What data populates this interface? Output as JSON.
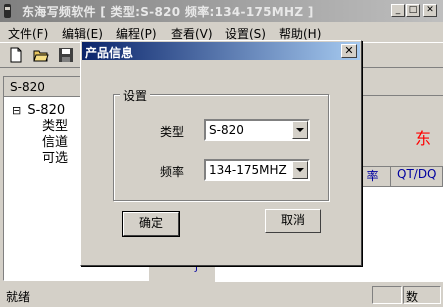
{
  "window": {
    "title": "东海写频软件  [ 类型:S-820  频率:134-175MHZ ]",
    "minimize": "_",
    "maximize": "□",
    "close": "✕"
  },
  "menu": [
    {
      "label": "文件(F)"
    },
    {
      "label": "编辑(E)"
    },
    {
      "label": "编程(P)"
    },
    {
      "label": "查看(V)"
    },
    {
      "label": "设置(S)"
    },
    {
      "label": "帮助(H)"
    }
  ],
  "toolbar": {
    "icons": [
      "new-file-icon",
      "open-folder-icon",
      "save-icon"
    ]
  },
  "left_pane": {
    "header": "S-820",
    "tree": [
      {
        "label": "S-820",
        "expander": "⊟"
      },
      {
        "label": "类型"
      },
      {
        "label": "信道"
      },
      {
        "label": "可选"
      }
    ]
  },
  "right_pane": {
    "brand_text": "东",
    "columns": [
      {
        "label": "率"
      },
      {
        "label": "QT/DQ"
      }
    ],
    "row_marker": "J"
  },
  "status": {
    "text": "就绪",
    "panel_label": "数"
  },
  "dialog": {
    "title": "产品信息",
    "close": "✕",
    "group_label": "设置",
    "type_label": "类型",
    "type_value": "S-820",
    "freq_label": "频率",
    "freq_value": "134-175MHZ",
    "ok_label": "确定",
    "cancel_label": "取消"
  },
  "colors": {
    "dialog_title_start": "#0a246a",
    "dialog_title_end": "#a6caf0",
    "brand_red": "#ff0000"
  }
}
